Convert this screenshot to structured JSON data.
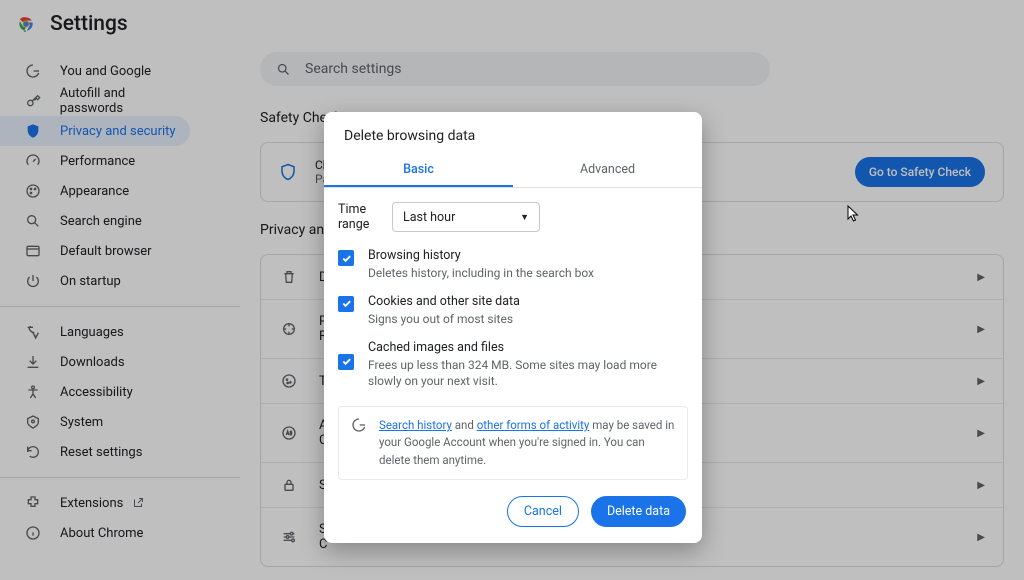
{
  "header": {
    "title": "Settings"
  },
  "search": {
    "placeholder": "Search settings"
  },
  "sidebar": {
    "items": [
      {
        "label": "You and Google"
      },
      {
        "label": "Autofill and passwords"
      },
      {
        "label": "Privacy and security"
      },
      {
        "label": "Performance"
      },
      {
        "label": "Appearance"
      },
      {
        "label": "Search engine"
      },
      {
        "label": "Default browser"
      },
      {
        "label": "On startup"
      }
    ],
    "items2": [
      {
        "label": "Languages"
      },
      {
        "label": "Downloads"
      },
      {
        "label": "Accessibility"
      },
      {
        "label": "System"
      },
      {
        "label": "Reset settings"
      }
    ],
    "items3": [
      {
        "label": "Extensions"
      },
      {
        "label": "About Chrome"
      }
    ]
  },
  "safety": {
    "section": "Safety Check",
    "line": "Chrome found some safety recommendations for your review",
    "sub": "Pa",
    "button": "Go to Safety Check"
  },
  "privacy": {
    "section": "Privacy and security",
    "rows": [
      {
        "label": "D"
      },
      {
        "label": "P",
        "sub": "R"
      },
      {
        "label": "T"
      },
      {
        "label": "A",
        "sub": "C"
      },
      {
        "label": "S"
      },
      {
        "label": "S",
        "sub": "C"
      }
    ]
  },
  "dialog": {
    "title": "Delete browsing data",
    "tabs": {
      "basic": "Basic",
      "advanced": "Advanced"
    },
    "time_label": "Time range",
    "time_value": "Last hour",
    "options": [
      {
        "title": "Browsing history",
        "desc": "Deletes history, including in the search box"
      },
      {
        "title": "Cookies and other site data",
        "desc": "Signs you out of most sites"
      },
      {
        "title": "Cached images and files",
        "desc": "Frees up less than 324 MB. Some sites may load more slowly on your next visit."
      }
    ],
    "notice": {
      "link1": "Search history",
      "mid1": " and ",
      "link2": "other forms of activity",
      "rest": " may be saved in your Google Account when you're signed in. You can delete them anytime."
    },
    "actions": {
      "cancel": "Cancel",
      "confirm": "Delete data"
    }
  }
}
